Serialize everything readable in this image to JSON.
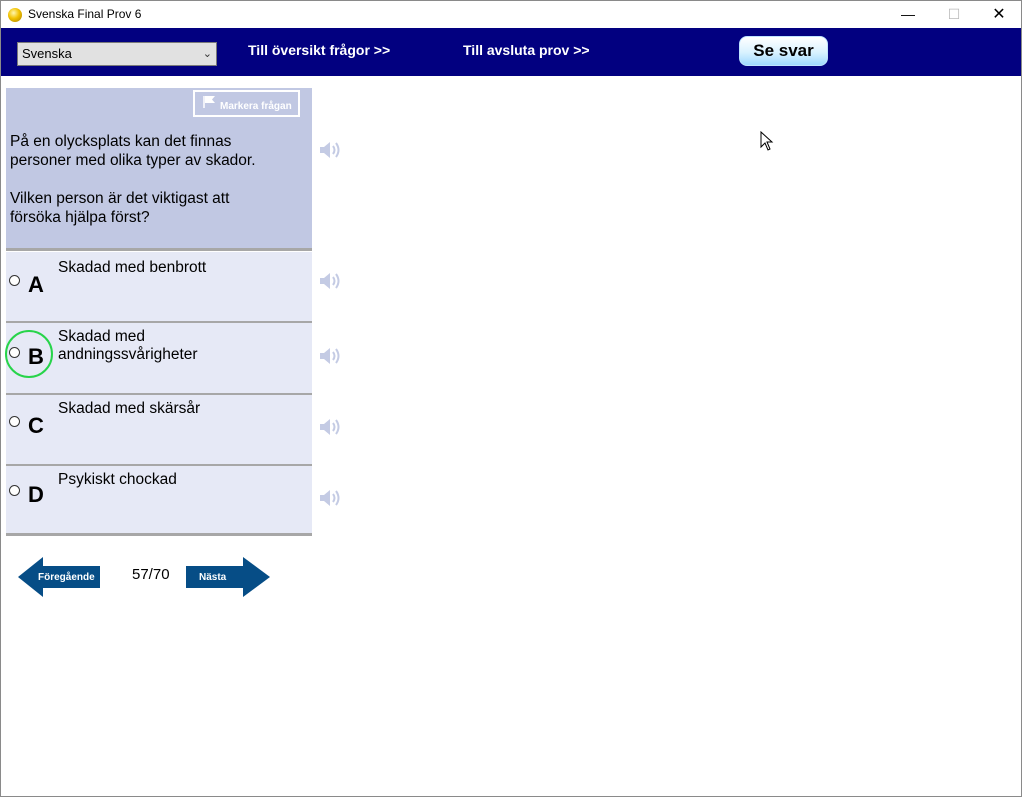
{
  "window": {
    "title": "Svenska Final Prov 6",
    "controls": {
      "minimize": "—",
      "maximize": "☐",
      "close": "✕"
    }
  },
  "nav": {
    "language": "Svenska",
    "overview_link": "Till översikt frågor >>",
    "finish_link": "Till avsluta prov  >>",
    "see_answer": "Se svar"
  },
  "question": {
    "flag_label": "Markera frågan",
    "text_line1": "På en olycksplats kan det finnas",
    "text_line2": "personer med olika typer av skador.",
    "text_line3": "Vilken person är det viktigast att",
    "text_line4": "försöka hjälpa först?"
  },
  "answers": [
    {
      "letter": "A",
      "line1": "Skadad med benbrott",
      "line2": ""
    },
    {
      "letter": "B",
      "line1": "Skadad med",
      "line2": "andningssvårigheter"
    },
    {
      "letter": "C",
      "line1": "Skadad med skärsår",
      "line2": ""
    },
    {
      "letter": "D",
      "line1": "Psykiskt chockad",
      "line2": ""
    }
  ],
  "navigation": {
    "previous": "Föregående",
    "next": "Nästa",
    "progress": "57/70"
  },
  "colors": {
    "navbar": "#020080",
    "question_bg": "#c1c8e3",
    "answer_bg": "#e6e9f6",
    "arrow": "#064d86",
    "highlight": "#27d44a"
  },
  "icons": [
    "app-icon",
    "flag-icon",
    "speaker-icon",
    "arrow-left-icon",
    "arrow-right-icon"
  ]
}
